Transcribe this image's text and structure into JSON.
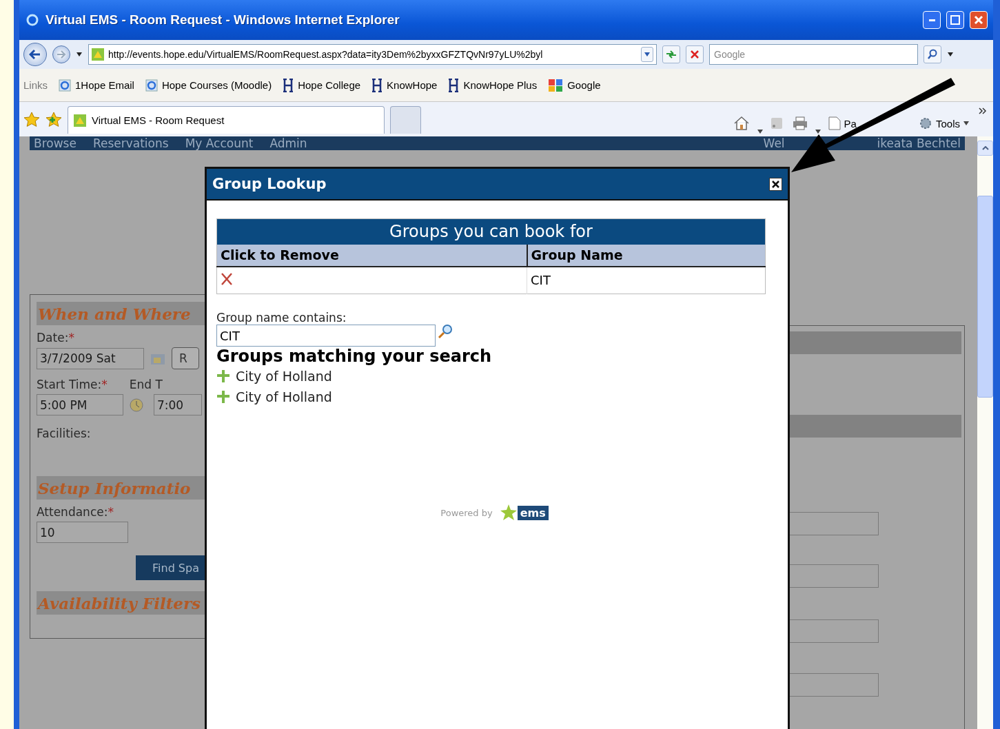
{
  "window": {
    "title": "Virtual EMS - Room Request - Windows Internet Explorer"
  },
  "address_bar": {
    "url": "http://events.hope.edu/VirtualEMS/RoomRequest.aspx?data=ity3Dem%2byxxGFZTQvNr97yLU%2byl",
    "search_placeholder": "Google"
  },
  "links_bar": {
    "label": "Links",
    "items": [
      {
        "label": "1Hope Email",
        "kind": "ie"
      },
      {
        "label": "Hope Courses (Moodle)",
        "kind": "ie"
      },
      {
        "label": "Hope College",
        "kind": "h"
      },
      {
        "label": "KnowHope",
        "kind": "h"
      },
      {
        "label": "KnowHope Plus",
        "kind": "h"
      },
      {
        "label": "Google",
        "kind": "google"
      }
    ]
  },
  "tabs": [
    {
      "label": "Virtual EMS - Room Request",
      "selected": true
    }
  ],
  "command_bar": {
    "page_label": "Pa",
    "tools_label": "Tools"
  },
  "nav": {
    "items": [
      "Browse",
      "Reservations",
      "My Account",
      "Admin"
    ],
    "welcome_parts": [
      "Wel",
      "ikeata Bechtel"
    ]
  },
  "form": {
    "sections": [
      "When and Where",
      "Setup Informatio",
      "Availability Filters"
    ],
    "date": {
      "label": "Date:",
      "mark": "*",
      "value": "3/7/2009 Sat",
      "button": "R"
    },
    "start_time": {
      "label": "Start Time:",
      "mark": "*",
      "value": "5:00 PM"
    },
    "end_time": {
      "label": "End T",
      "value": "7:00"
    },
    "facilities": {
      "label": "Facilities:"
    },
    "attendance": {
      "label": "Attendance:",
      "mark": "*",
      "value": "10"
    },
    "find_button": "Find Spa"
  },
  "dialog": {
    "title": "Group Lookup",
    "bookable": {
      "caption": "Groups you can book for",
      "columns": [
        "Click to Remove",
        "Group Name"
      ],
      "rows": [
        {
          "group": "CIT"
        }
      ]
    },
    "search": {
      "label": "Group name contains:",
      "value": "CIT"
    },
    "results_heading": "Groups matching your search",
    "results": [
      "City of Holland",
      "City of Holland"
    ],
    "powered_by": "Powered by",
    "logo_text": "ems"
  }
}
